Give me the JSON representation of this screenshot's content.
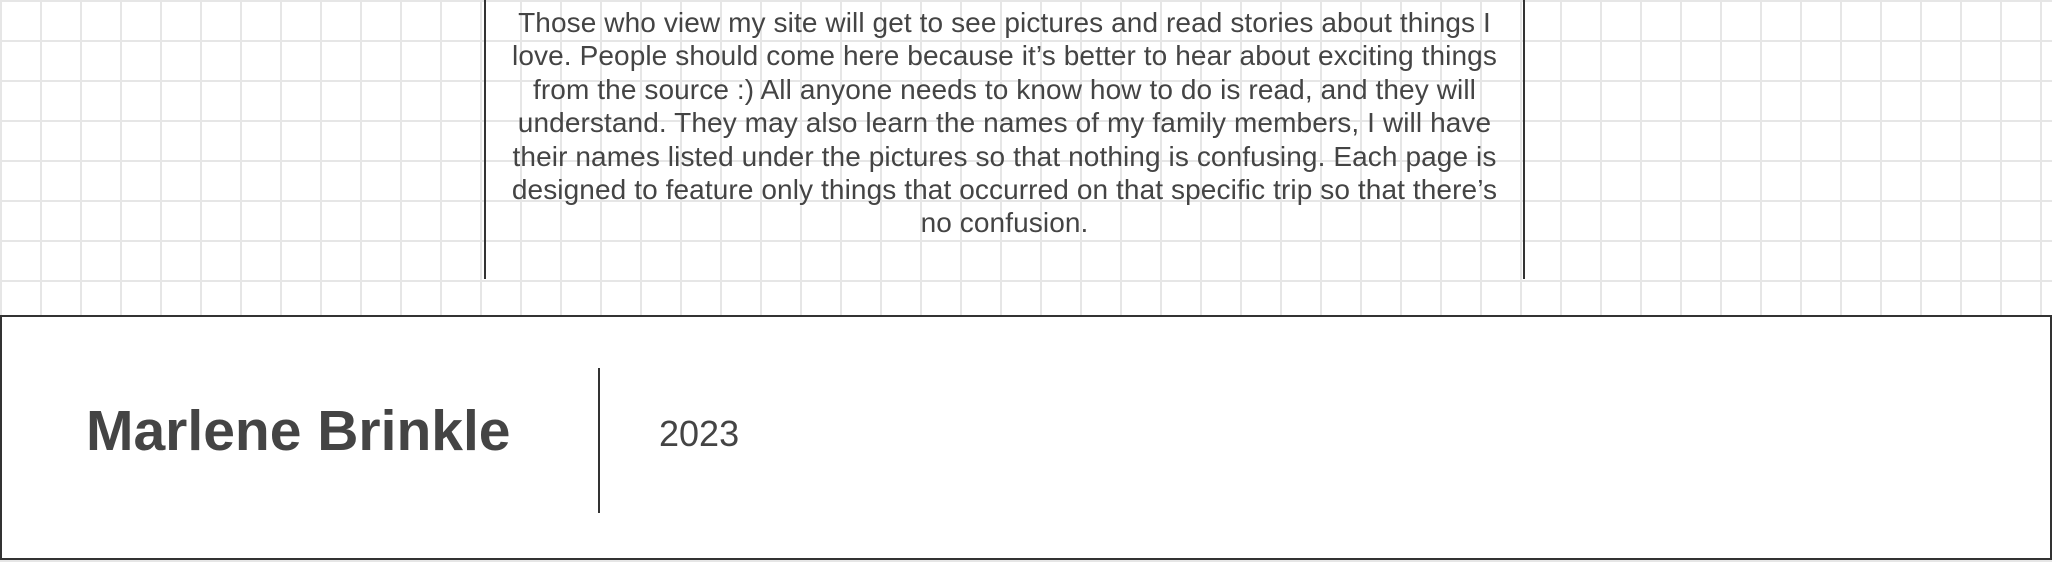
{
  "intro": {
    "text": "Those who view my site will get to see pictures and read stories about things I love. People should come here because it’s better to hear about exciting things from the source :) All anyone needs to know how to do is read, and they will understand. They may also learn the names of my family members, I will have their names listed under the pictures so that nothing is confusing. Each page is designed to feature only things that occurred on that specific trip so that there’s no confusion."
  },
  "footer": {
    "author": "Marlene Brinkle",
    "year": "2023"
  },
  "colors": {
    "text": "#444444",
    "border": "#333333",
    "grid": "#e6e6e6",
    "background": "#ffffff"
  }
}
